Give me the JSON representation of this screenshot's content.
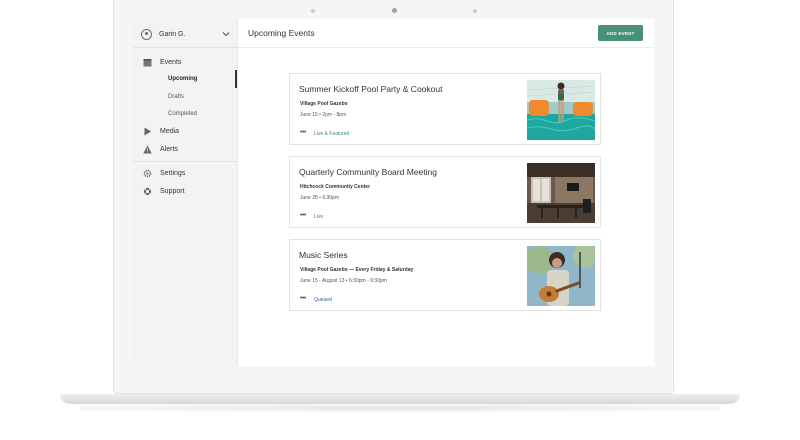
{
  "user": {
    "name": "Garin G."
  },
  "header": {
    "title": "Upcoming Events",
    "add_button": "ADD EVENT"
  },
  "sidebar": {
    "events_label": "Events",
    "event_subitems": [
      "Upcoming",
      "Drafts",
      "Completed"
    ],
    "media_label": "Media",
    "alerts_label": "Alerts",
    "settings_label": "Settings",
    "support_label": "Support",
    "active_subitem": "Upcoming"
  },
  "events": [
    {
      "title": "Summer Kickoff Pool Party & Cookout",
      "location": "Village Pool Gazebo",
      "date": "June 15 • 2pm - 8pm",
      "status": "Live & Featured",
      "status_color": "#3d8a6d",
      "image": "pool-party-photo"
    },
    {
      "title": "Quarterly Community Board Meeting",
      "location": "Hitchcock Community Center",
      "date": "June 28 • 6:30pm",
      "status": "Live",
      "status_color": "#3d8a6d",
      "image": "meeting-room-photo"
    },
    {
      "title": "Music Series",
      "location": "Village Pool Gazebo — Every Friday & Saturday",
      "date": "June 15 - August 13 • 6:30pm - 9:30pm",
      "status": "Queued",
      "status_color": "#2f5d9e",
      "image": "guitarist-photo"
    }
  ],
  "colors": {
    "accent": "#479276",
    "sidebar_bg": "#f3f3f3"
  }
}
